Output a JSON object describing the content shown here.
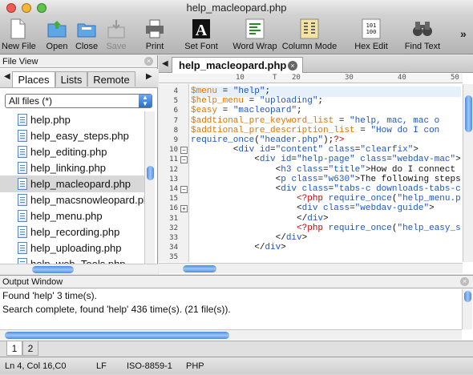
{
  "window": {
    "title": "help_macleopard.php"
  },
  "toolbar": [
    {
      "label": "New File",
      "icon": "new-file-icon"
    },
    {
      "label": "Open",
      "icon": "open-folder-icon"
    },
    {
      "label": "Close",
      "icon": "close-folder-icon"
    },
    {
      "label": "Save",
      "icon": "save-icon"
    },
    {
      "label": "Print",
      "icon": "print-icon"
    },
    {
      "label": "Set Font",
      "icon": "font-icon"
    },
    {
      "label": "Word Wrap",
      "icon": "word-wrap-icon"
    },
    {
      "label": "Column Mode",
      "icon": "column-mode-icon"
    },
    {
      "label": "Hex Edit",
      "icon": "hex-edit-icon"
    },
    {
      "label": "Find Text",
      "icon": "binoculars-icon"
    }
  ],
  "toolbar_more": "»",
  "file_view": {
    "title": "File View",
    "tabs": [
      "Places",
      "Lists",
      "Remote"
    ],
    "filter": "All files (*)",
    "files": [
      "help.php",
      "help_easy_steps.php",
      "help_editing.php",
      "help_linking.php",
      "help_macleopard.php",
      "help_macsnowleopard.php",
      "help_menu.php",
      "help_recording.php",
      "help_uploading.php",
      "help_web_Tools.php"
    ],
    "selected_index": 4
  },
  "editor": {
    "tab": "help_macleopard.php",
    "ruler": [
      "10",
      "T",
      "20",
      "30",
      "40",
      "50",
      "60"
    ],
    "lines": [
      {
        "n": "4",
        "segs": [
          [
            "v",
            "$menu"
          ],
          [
            "t",
            " = "
          ],
          [
            "s",
            "\"help\""
          ],
          [
            "t",
            ";"
          ]
        ]
      },
      {
        "n": "5",
        "segs": [
          [
            "v",
            "$help_menu"
          ],
          [
            "t",
            " = "
          ],
          [
            "s",
            "\"uploading\""
          ],
          [
            "t",
            ";"
          ]
        ]
      },
      {
        "n": "6",
        "segs": [
          [
            "v",
            "$easy"
          ],
          [
            "t",
            " = "
          ],
          [
            "s",
            "\"macleopard\""
          ],
          [
            "t",
            ";"
          ]
        ]
      },
      {
        "n": "7",
        "segs": [
          [
            "v",
            "$addtional_pre_keyword_list"
          ],
          [
            "t",
            " = "
          ],
          [
            "s",
            "\"help, mac, mac o"
          ]
        ]
      },
      {
        "n": "8",
        "segs": [
          [
            "v",
            "$addtional_pre_description_list"
          ],
          [
            "t",
            " = "
          ],
          [
            "s",
            "\"How do I con"
          ]
        ]
      },
      {
        "n": "9",
        "segs": [
          [
            "p",
            "require_once"
          ],
          [
            "t",
            "("
          ],
          [
            "s",
            "\"header.php\""
          ],
          [
            "t",
            ");"
          ],
          [
            "r",
            "?>"
          ]
        ]
      },
      {
        "n": "10",
        "fold": "−",
        "segs": [
          [
            "t",
            "        <"
          ],
          [
            "k",
            "div"
          ],
          [
            "t",
            " "
          ],
          [
            "a",
            "id"
          ],
          [
            "t",
            "="
          ],
          [
            "s",
            "\"content\""
          ],
          [
            "t",
            " "
          ],
          [
            "a",
            "class"
          ],
          [
            "t",
            "="
          ],
          [
            "s",
            "\"clearfix\""
          ],
          [
            "t",
            ">"
          ]
        ]
      },
      {
        "n": "11",
        "fold": "−",
        "segs": [
          [
            "t",
            "            <"
          ],
          [
            "k",
            "div"
          ],
          [
            "t",
            " "
          ],
          [
            "a",
            "id"
          ],
          [
            "t",
            "="
          ],
          [
            "s",
            "\"help-page\""
          ],
          [
            "t",
            " "
          ],
          [
            "a",
            "class"
          ],
          [
            "t",
            "="
          ],
          [
            "s",
            "\"webdav-mac\""
          ],
          [
            "t",
            ">"
          ]
        ]
      },
      {
        "n": "12",
        "segs": [
          [
            "t",
            "                <"
          ],
          [
            "k",
            "h3"
          ],
          [
            "t",
            " "
          ],
          [
            "a",
            "class"
          ],
          [
            "t",
            "="
          ],
          [
            "s",
            "\"title\""
          ],
          [
            "t",
            ">How do I connect to"
          ]
        ]
      },
      {
        "n": "13",
        "segs": [
          [
            "t",
            "                <"
          ],
          [
            "k",
            "p"
          ],
          [
            "t",
            " "
          ],
          [
            "a",
            "class"
          ],
          [
            "t",
            "="
          ],
          [
            "s",
            "\"w630\""
          ],
          [
            "t",
            ">The following steps w"
          ]
        ]
      },
      {
        "n": "14",
        "fold": "−",
        "segs": [
          [
            "t",
            "                <"
          ],
          [
            "k",
            "div"
          ],
          [
            "t",
            " "
          ],
          [
            "a",
            "class"
          ],
          [
            "t",
            "="
          ],
          [
            "s",
            "\"tabs-c downloads-tabs-c\""
          ],
          [
            "t",
            ">"
          ]
        ]
      },
      {
        "n": "15",
        "segs": [
          [
            "t",
            "                    "
          ],
          [
            "r",
            "<?php"
          ],
          [
            "t",
            " "
          ],
          [
            "p",
            "require_once"
          ],
          [
            "t",
            "("
          ],
          [
            "s",
            "\"help_menu.php\""
          ],
          [
            "t",
            ")"
          ]
        ]
      },
      {
        "n": "16",
        "fold": "+",
        "segs": [
          [
            "t",
            "                    <"
          ],
          [
            "k",
            "div"
          ],
          [
            "t",
            " "
          ],
          [
            "a",
            "class"
          ],
          [
            "t",
            "="
          ],
          [
            "s",
            "\"webdav-guide\""
          ],
          [
            "t",
            ">"
          ]
        ]
      },
      {
        "n": "31",
        "segs": [
          [
            "t",
            "                    </"
          ],
          [
            "k",
            "div"
          ],
          [
            "t",
            ">"
          ]
        ]
      },
      {
        "n": "32",
        "segs": [
          [
            "t",
            "                    "
          ],
          [
            "r",
            "<?php"
          ],
          [
            "t",
            " "
          ],
          [
            "p",
            "require_once"
          ],
          [
            "t",
            "("
          ],
          [
            "s",
            "\"help_easy_steps"
          ]
        ]
      },
      {
        "n": "33",
        "segs": [
          [
            "t",
            "                </"
          ],
          [
            "k",
            "div"
          ],
          [
            "t",
            ">"
          ]
        ]
      },
      {
        "n": "34",
        "segs": [
          [
            "t",
            "            </"
          ],
          [
            "k",
            "div"
          ],
          [
            "t",
            ">"
          ]
        ]
      },
      {
        "n": "35",
        "segs": []
      },
      {
        "n": "36",
        "segs": []
      }
    ],
    "current_line_index": 0
  },
  "output": {
    "title": "Output Window",
    "lines": [
      "Found 'help' 3 time(s).",
      "Search complete, found 'help' 436 time(s). (21 file(s))."
    ],
    "tabs": [
      "1",
      "2"
    ],
    "active_tab": 0
  },
  "status": {
    "position": "Ln 4, Col 16,C0",
    "line_ending": "LF",
    "encoding": "ISO-8859-1",
    "syntax": "PHP"
  },
  "colors": {
    "variable": "#e07400",
    "string": "#1f56c4",
    "php_tag": "#cc0000",
    "selection": "#d8d8d8",
    "scroll_thumb": "#4d8be0"
  }
}
